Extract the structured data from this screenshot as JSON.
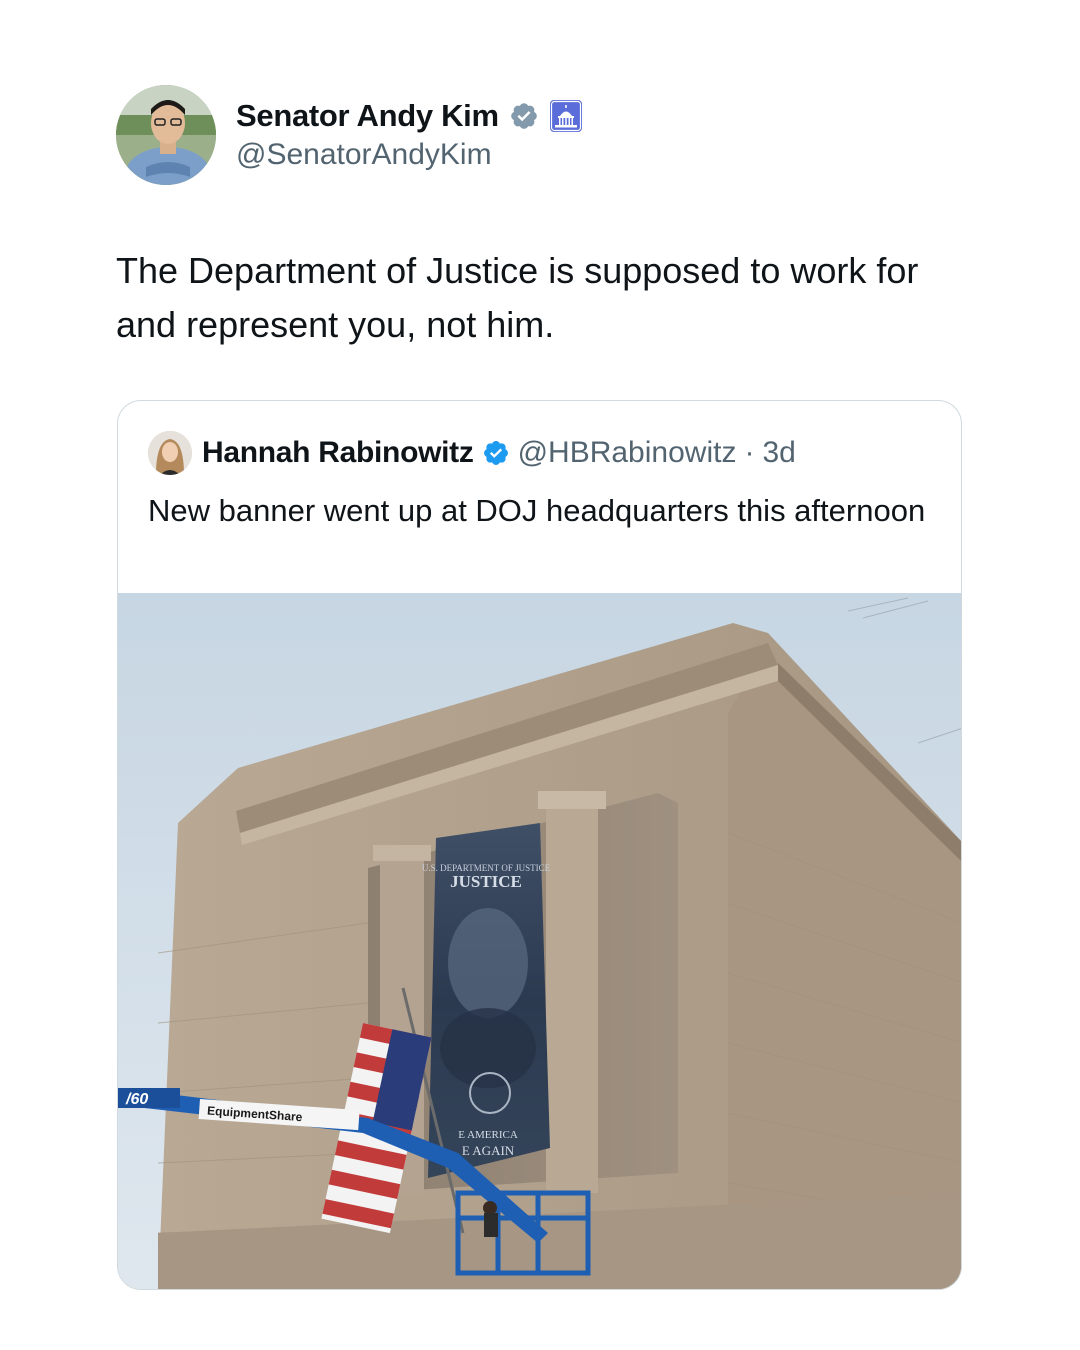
{
  "author": {
    "name": "Senator Andy Kim",
    "handle": "@SenatorAndyKim",
    "verified_icon": "verified-gray-badge",
    "affiliation_icon": "capitol-building-icon"
  },
  "tweet": {
    "text": "The Department of Justice is supposed to work for and represent you, not him."
  },
  "quoted_tweet": {
    "name": "Hannah Rabinowitz",
    "handle": "@HBRabinowitz",
    "separator": "·",
    "time": "3d",
    "verified_icon": "verified-blue-badge",
    "text": "New banner went up at DOJ headquarters this afternoon",
    "photo": {
      "banner_top": "U.S. DEPARTMENT OF JUSTICE",
      "banner_title": "JUSTICE",
      "banner_bottom_1": "E AMERICA",
      "banner_bottom_2": "E AGAIN",
      "lift_number": "/60",
      "lift_brand": "EquipmentShare"
    }
  },
  "colors": {
    "text_primary": "#0f1419",
    "text_secondary": "#536471",
    "verified_blue": "#1d9bf0",
    "border": "#cfd9de"
  }
}
